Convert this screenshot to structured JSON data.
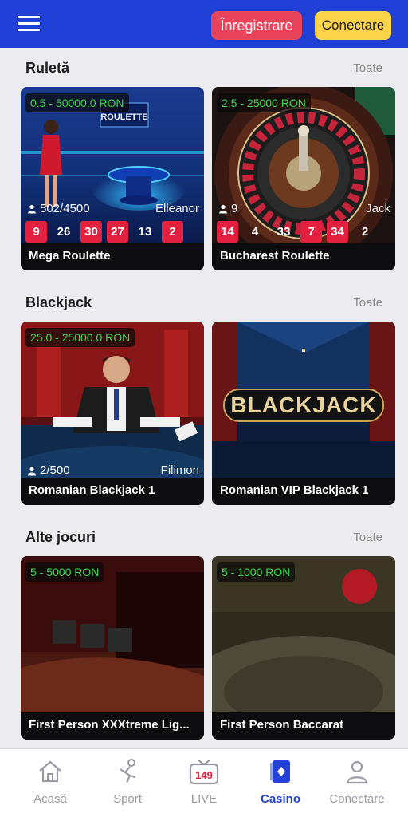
{
  "header": {
    "register_label": "Înregistrare",
    "login_label": "Conectare",
    "menu_icon": "hamburger-menu-icon",
    "bg_color": "#1f3fd6"
  },
  "sections": {
    "roulette": {
      "title": "Ruletă",
      "see_all": "Toate",
      "cards": [
        {
          "name": "Mega Roulette",
          "limit": "0.5 - 50000.0 RON",
          "players": "502/4500",
          "dealer": "Elleanor",
          "results": [
            "9",
            "26",
            "30",
            "27",
            "13",
            "2"
          ]
        },
        {
          "name": "Bucharest Roulette",
          "limit": "2.5 - 25000 RON",
          "players": "9",
          "dealer": "Jack",
          "results": [
            "14",
            "4",
            "33",
            "7",
            "34",
            "2"
          ]
        }
      ]
    },
    "blackjack": {
      "title": "Blackjack",
      "see_all": "Toate",
      "cards": [
        {
          "name": "Romanian Blackjack 1",
          "limit": "25.0 - 25000.0 RON",
          "players": "2/500",
          "dealer": "Filimon"
        },
        {
          "name": "Romanian VIP Blackjack 1",
          "logo_text": "BLACKJACK"
        }
      ]
    },
    "other": {
      "title": "Alte jocuri",
      "see_all": "Toate",
      "cards": [
        {
          "name": "First Person XXXtreme Lig...",
          "limit": "5 - 5000 RON"
        },
        {
          "name": "First Person Baccarat",
          "limit": "5 - 1000 RON"
        }
      ]
    }
  },
  "bottom_nav": {
    "items": [
      {
        "label": "Acasă",
        "icon": "home-icon"
      },
      {
        "label": "Sport",
        "icon": "sport-icon"
      },
      {
        "label": "LIVE",
        "icon": "live-tv-icon",
        "badge": "149"
      },
      {
        "label": "Casino",
        "icon": "casino-cards-icon",
        "active": true
      },
      {
        "label": "Conectare",
        "icon": "user-icon"
      }
    ],
    "active_color": "#2442d6"
  }
}
